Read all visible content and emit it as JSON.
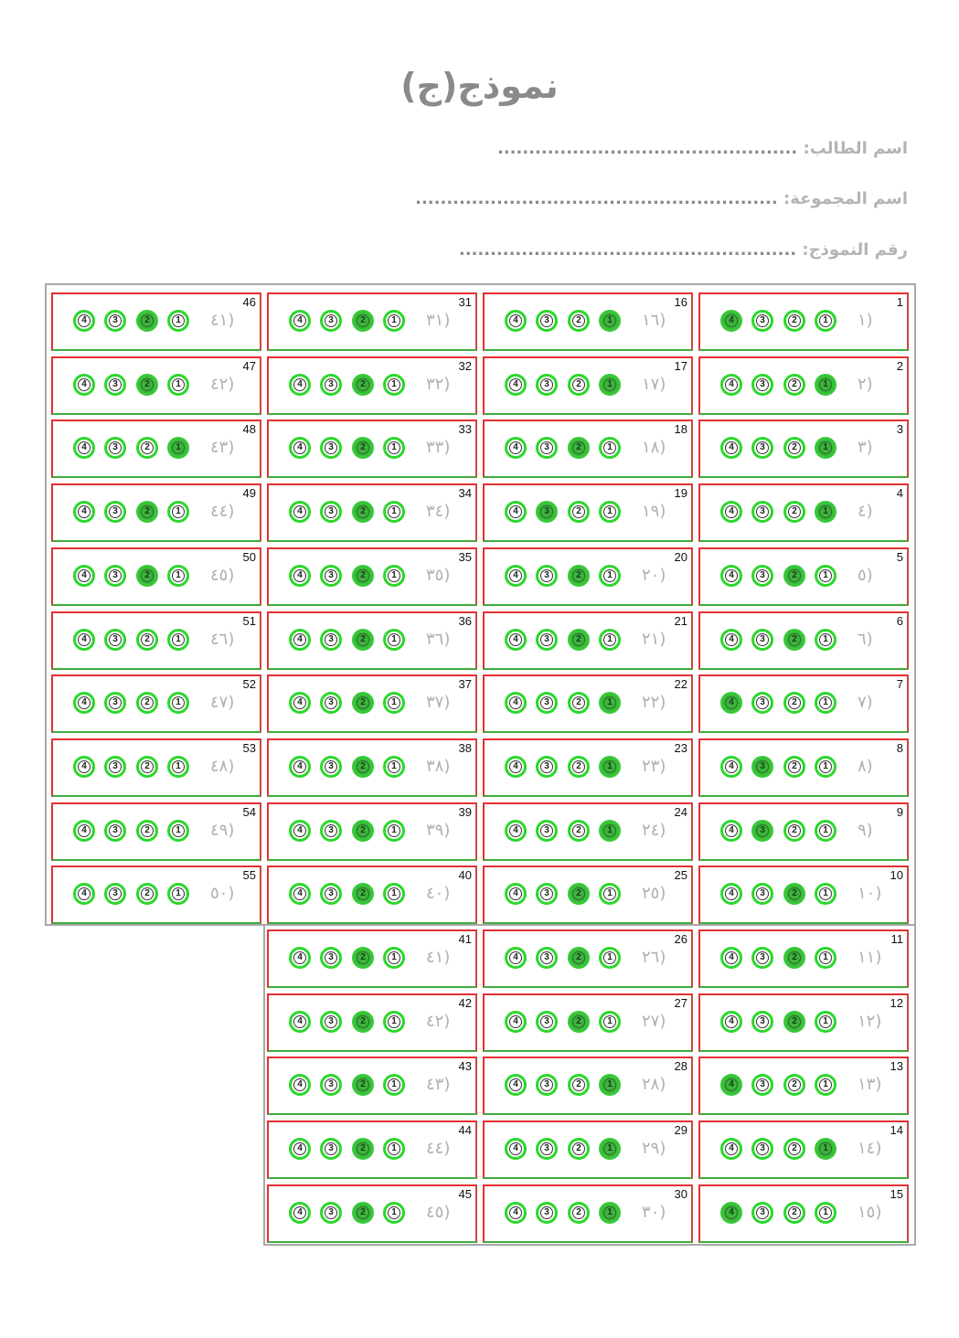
{
  "title": "نموذج(ج)",
  "fields": [
    {
      "label": "اسم الطالب:",
      "dots": "................................................"
    },
    {
      "label": "اسم المجموعة:",
      "dots": ".........................................................."
    },
    {
      "label": "رقم النموذج:",
      "dots": "......................................................"
    }
  ],
  "colors": {
    "bubble_ring": "#2ad82a",
    "bubble_fill": "#3cb43c",
    "cell_border": "#e53030"
  },
  "options": [
    "4",
    "3",
    "2",
    "1"
  ],
  "questions": [
    {
      "n": 1,
      "label": "١)",
      "mark": 4
    },
    {
      "n": 2,
      "label": "٢)",
      "mark": 1
    },
    {
      "n": 3,
      "label": "٣)",
      "mark": 1
    },
    {
      "n": 4,
      "label": "٤)",
      "mark": 1
    },
    {
      "n": 5,
      "label": "٥)",
      "mark": 2
    },
    {
      "n": 6,
      "label": "٦)",
      "mark": 2
    },
    {
      "n": 7,
      "label": "٧)",
      "mark": 4
    },
    {
      "n": 8,
      "label": "٨)",
      "mark": 3
    },
    {
      "n": 9,
      "label": "٩)",
      "mark": 3
    },
    {
      "n": 10,
      "label": "١٠)",
      "mark": 2
    },
    {
      "n": 11,
      "label": "١١)",
      "mark": 2
    },
    {
      "n": 12,
      "label": "١٢)",
      "mark": 2
    },
    {
      "n": 13,
      "label": "١٣)",
      "mark": 4
    },
    {
      "n": 14,
      "label": "١٤)",
      "mark": 1
    },
    {
      "n": 15,
      "label": "١٥)",
      "mark": 4
    },
    {
      "n": 16,
      "label": "١٦)",
      "mark": 1
    },
    {
      "n": 17,
      "label": "١٧)",
      "mark": 1
    },
    {
      "n": 18,
      "label": "١٨)",
      "mark": 2
    },
    {
      "n": 19,
      "label": "١٩)",
      "mark": 3
    },
    {
      "n": 20,
      "label": "٢٠)",
      "mark": 2
    },
    {
      "n": 21,
      "label": "٢١)",
      "mark": 2
    },
    {
      "n": 22,
      "label": "٢٢)",
      "mark": 1
    },
    {
      "n": 23,
      "label": "٢٣)",
      "mark": 1
    },
    {
      "n": 24,
      "label": "٢٤)",
      "mark": 1
    },
    {
      "n": 25,
      "label": "٢٥)",
      "mark": 2
    },
    {
      "n": 26,
      "label": "٢٦)",
      "mark": 2
    },
    {
      "n": 27,
      "label": "٢٧)",
      "mark": 2
    },
    {
      "n": 28,
      "label": "٢٨)",
      "mark": 1
    },
    {
      "n": 29,
      "label": "٢٩)",
      "mark": 1
    },
    {
      "n": 30,
      "label": "٣٠)",
      "mark": 1
    },
    {
      "n": 31,
      "label": "٣١)",
      "mark": 2
    },
    {
      "n": 32,
      "label": "٣٢)",
      "mark": 2
    },
    {
      "n": 33,
      "label": "٣٣)",
      "mark": 2
    },
    {
      "n": 34,
      "label": "٣٤)",
      "mark": 2
    },
    {
      "n": 35,
      "label": "٣٥)",
      "mark": 2
    },
    {
      "n": 36,
      "label": "٣٦)",
      "mark": 2
    },
    {
      "n": 37,
      "label": "٣٧)",
      "mark": 2
    },
    {
      "n": 38,
      "label": "٣٨)",
      "mark": 2
    },
    {
      "n": 39,
      "label": "٣٩)",
      "mark": 2
    },
    {
      "n": 40,
      "label": "٤٠)",
      "mark": 2
    },
    {
      "n": 41,
      "label": "٤١)",
      "mark": 2
    },
    {
      "n": 42,
      "label": "٤٢)",
      "mark": 2
    },
    {
      "n": 43,
      "label": "٤٣)",
      "mark": 2
    },
    {
      "n": 44,
      "label": "٤٤)",
      "mark": 2
    },
    {
      "n": 45,
      "label": "٤٥)",
      "mark": 2
    },
    {
      "n": 46,
      "label": "٤١)",
      "mark": 2
    },
    {
      "n": 47,
      "label": "٤٢)",
      "mark": 2
    },
    {
      "n": 48,
      "label": "٤٣)",
      "mark": 1
    },
    {
      "n": 49,
      "label": "٤٤)",
      "mark": 2
    },
    {
      "n": 50,
      "label": "٤٥)",
      "mark": 2
    },
    {
      "n": 51,
      "label": "٤٦)",
      "mark": 0
    },
    {
      "n": 52,
      "label": "٤٧)",
      "mark": 0
    },
    {
      "n": 53,
      "label": "٤٨)",
      "mark": 0
    },
    {
      "n": 54,
      "label": "٤٩)",
      "mark": 0
    },
    {
      "n": 55,
      "label": "٥٠)",
      "mark": 0
    }
  ]
}
